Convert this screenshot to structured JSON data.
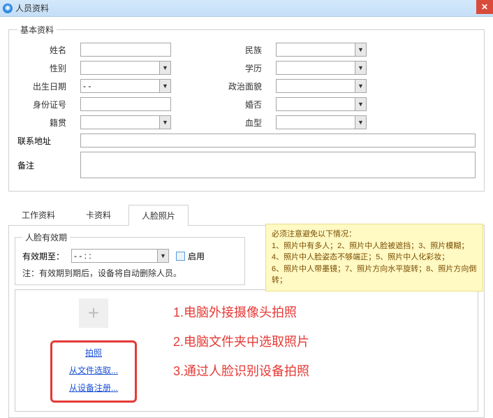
{
  "titlebar": {
    "title": "人员资料"
  },
  "basic": {
    "legend": "基本资料",
    "labels": {
      "name": "姓名",
      "gender": "性别",
      "birth": "出生日期",
      "id": "身份证号",
      "origin": "籍贯",
      "ethnic": "民族",
      "edu": "学历",
      "political": "政治面貌",
      "marital": "婚否",
      "blood": "血型",
      "address": "联系地址",
      "remark": "备注"
    },
    "values": {
      "name": "",
      "gender": "",
      "birth": "  -   -",
      "id": "",
      "origin": "",
      "ethnic": "",
      "edu": "",
      "political": "",
      "marital": "",
      "blood": "",
      "address": "",
      "remark": ""
    }
  },
  "tabs": {
    "work": "工作资料",
    "card": "卡资料",
    "face": "人脸照片"
  },
  "face": {
    "valid_legend": "人脸有效期",
    "valid_label": "有效期至：",
    "valid_value": "  -   -       :    :",
    "enable_label": "启用",
    "note": "注：有效期到期后，设备将自动删除人员。",
    "warn_title": "必须注意避免以下情况：",
    "warn_body": "1、照片中有多人；2、照片中人脸被遮挡；3、照片模糊；\n4、照片中人脸姿态不够端正；5、照片中人化彩妆；\n6、照片中人带墨镜；7、照片方向水平旋转；8、照片方向倒转；",
    "links": {
      "capture": "拍照",
      "file": "从文件选取...",
      "device": "从设备注册..."
    },
    "instructions": {
      "i1": "1.电脑外接摄像头拍照",
      "i2": "2.电脑文件夹中选取照片",
      "i3": "3.通过人脸识别设备拍照"
    }
  }
}
